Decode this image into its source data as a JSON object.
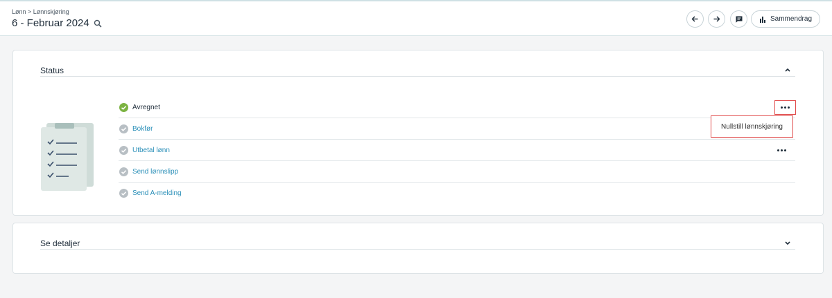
{
  "header": {
    "breadcrumb": "Lønn > Lønnskjøring",
    "title": "6 - Februar 2024",
    "summary_label": "Sammendrag"
  },
  "status_card": {
    "title": "Status",
    "steps": [
      {
        "label": "Avregnet",
        "state": "done",
        "has_menu": true
      },
      {
        "label": "Bokfør",
        "state": "pending",
        "has_menu": false
      },
      {
        "label": "Utbetal lønn",
        "state": "pending",
        "has_menu": true
      },
      {
        "label": "Send lønnslipp",
        "state": "pending",
        "has_menu": false
      },
      {
        "label": "Send A-melding",
        "state": "pending",
        "has_menu": false
      }
    ],
    "popover_label": "Nullstill lønnskjøring"
  },
  "details_card": {
    "title": "Se detaljer"
  },
  "colors": {
    "done": "#7cb342",
    "pending": "#b8bfc4",
    "link": "#2a8fb8",
    "highlight": "#e04a4a"
  }
}
